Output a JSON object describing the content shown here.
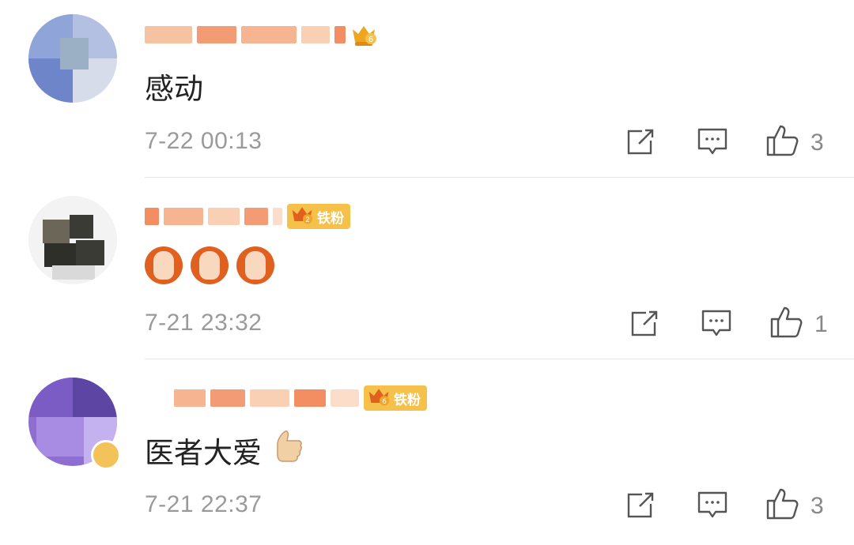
{
  "comments": [
    {
      "text": "感动",
      "time": "7-22 00:13",
      "likes": "3",
      "level": "6",
      "fan_badge": "",
      "avatar_colors": [
        "#c7cfe6",
        "#8fa4d8",
        "#aab8e4",
        "#6e86c9",
        "#d7dceb",
        "#9bb0c4",
        "#eef0f5"
      ]
    },
    {
      "text": "",
      "emoji_count": 3,
      "time": "7-21 23:32",
      "likes": "1",
      "level": "2",
      "fan_badge": "铁粉",
      "avatar_colors": [
        "#f3f3f3",
        "#3b3b35",
        "#6b6658",
        "#d9d9d9",
        "#2f2f2a",
        "#b7b2a4",
        "#ffffff"
      ]
    },
    {
      "text": "医者大爱",
      "time": "7-21 22:37",
      "likes": "3",
      "level": "6",
      "fan_badge": "铁粉",
      "avatar_colors": [
        "#8e6fd1",
        "#7b5cc4",
        "#a88be3",
        "#5d46a3",
        "#c4b1ef",
        "#3b2a73",
        "#f3c35a"
      ]
    }
  ],
  "icons": {
    "share": "share-icon",
    "reply": "reply-icon",
    "like": "like-icon",
    "crown": "crown-icon",
    "thumbs_up_emoji": "thumbs-up-emoji-icon",
    "clapping_emoji": "victory-hands-emoji-icon"
  },
  "colors": {
    "time": "#9a9a9a",
    "divider": "#e5e5e5",
    "badge": "#f6c14a",
    "crown": "#f0a521"
  }
}
